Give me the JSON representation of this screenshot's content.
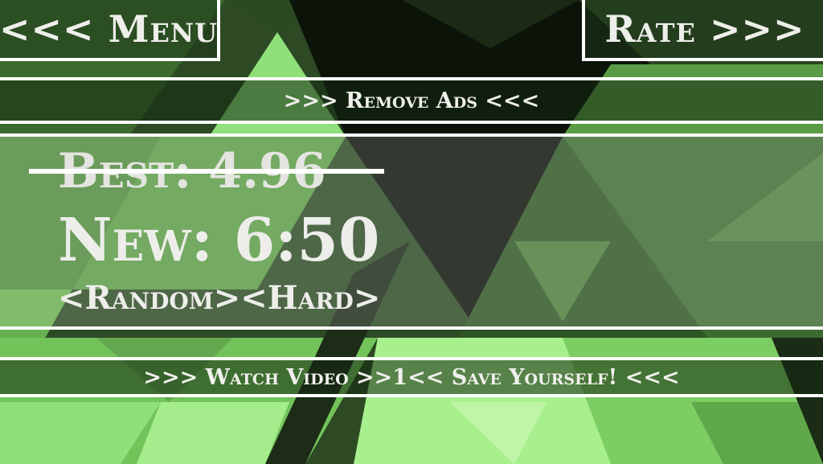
{
  "header": {
    "menu_label": "<<< Menu",
    "rate_label": "Rate >>>"
  },
  "banners": {
    "remove_ads": ">>> Remove Ads <<<",
    "watch_video": ">>> Watch Video >>1<< Save Yourself! <<<"
  },
  "score": {
    "best": "Best: 4.96",
    "new": "New: 6:50",
    "mode": "<Random><Hard>"
  },
  "colors": {
    "dark": "#0c1409",
    "mid": "#3e6a30",
    "light": "#8fe07a",
    "accent": "#b4f39c",
    "lines": "#ffffff"
  }
}
